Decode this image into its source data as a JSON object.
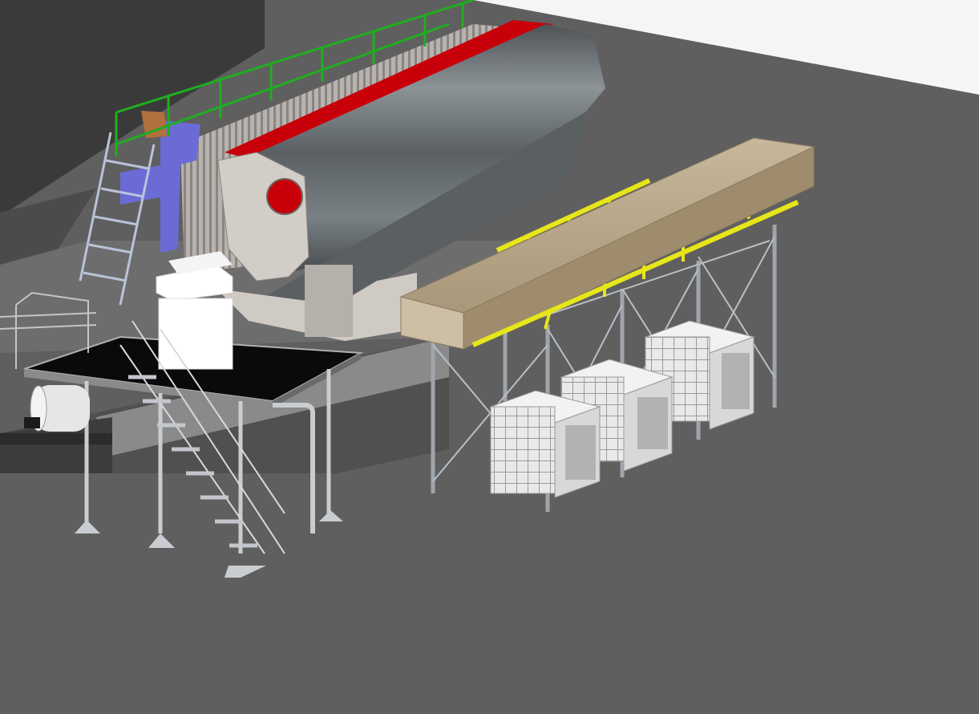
{
  "scene": {
    "kind": "3d-cad-viewport",
    "colors": {
      "floor": "#5f5f5f",
      "back_wall": "#3a3a3a",
      "sky": "#f4f5f7",
      "machine_body": "#6f7478",
      "machine_highlight": "#9aa0a4",
      "accent_red": "#c8000a",
      "railing_green": "#1fae1f",
      "duct_purple": "#6b6bd6",
      "beam_tan": "#b9a88c",
      "frame_yellow": "#e6e61a",
      "steel_grey": "#aab0b6",
      "platform_black": "#0a0a0a",
      "control_cabinet": "#ffffff",
      "tote_white": "#e8e8e8"
    },
    "objects": [
      {
        "id": "back-wall",
        "label": ""
      },
      {
        "id": "press-machine",
        "label": ""
      },
      {
        "id": "walkway-railing",
        "label": ""
      },
      {
        "id": "access-ladder",
        "label": ""
      },
      {
        "id": "operator-platform",
        "label": ""
      },
      {
        "id": "control-cabinet",
        "label": ""
      },
      {
        "id": "platform-stairs",
        "label": ""
      },
      {
        "id": "conveyor-beam",
        "label": ""
      },
      {
        "id": "yellow-truss",
        "label": ""
      },
      {
        "id": "support-frame",
        "label": ""
      },
      {
        "id": "ibc-tote",
        "count": 3
      }
    ]
  }
}
